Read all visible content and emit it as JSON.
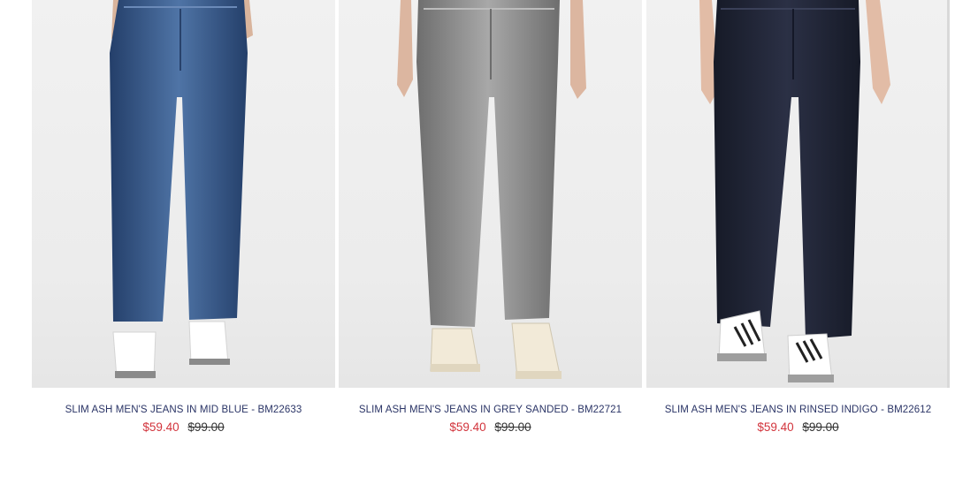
{
  "products": [
    {
      "title": "SLIM ASH MEN'S JEANS IN MID BLUE - BM22633",
      "sale_price": "$59.40",
      "original_price": "$99.00",
      "image": "product-photo-jeans-mid-blue",
      "denim_color": "#2c4a78",
      "denim_highlight": "#5478a8",
      "shoe": "white sneakers"
    },
    {
      "title": "SLIM ASH MEN'S JEANS IN GREY SANDED - BM22721",
      "sale_price": "$59.40",
      "original_price": "$99.00",
      "image": "product-photo-jeans-grey-sanded",
      "denim_color": "#7c7c7c",
      "denim_highlight": "#a6a6a6",
      "shoe": "cream canvas high-tops"
    },
    {
      "title": "SLIM ASH MEN'S JEANS IN RINSED INDIGO - BM22612",
      "sale_price": "$59.40",
      "original_price": "$99.00",
      "image": "product-photo-jeans-rinsed-indigo",
      "denim_color": "#1c2030",
      "denim_highlight": "#2e3348",
      "shoe": "white sneakers with black stripes"
    }
  ],
  "colors": {
    "title": "#2a3466",
    "sale_price": "#d2343c",
    "original_price": "#333333",
    "photo_background": "#ececec"
  }
}
